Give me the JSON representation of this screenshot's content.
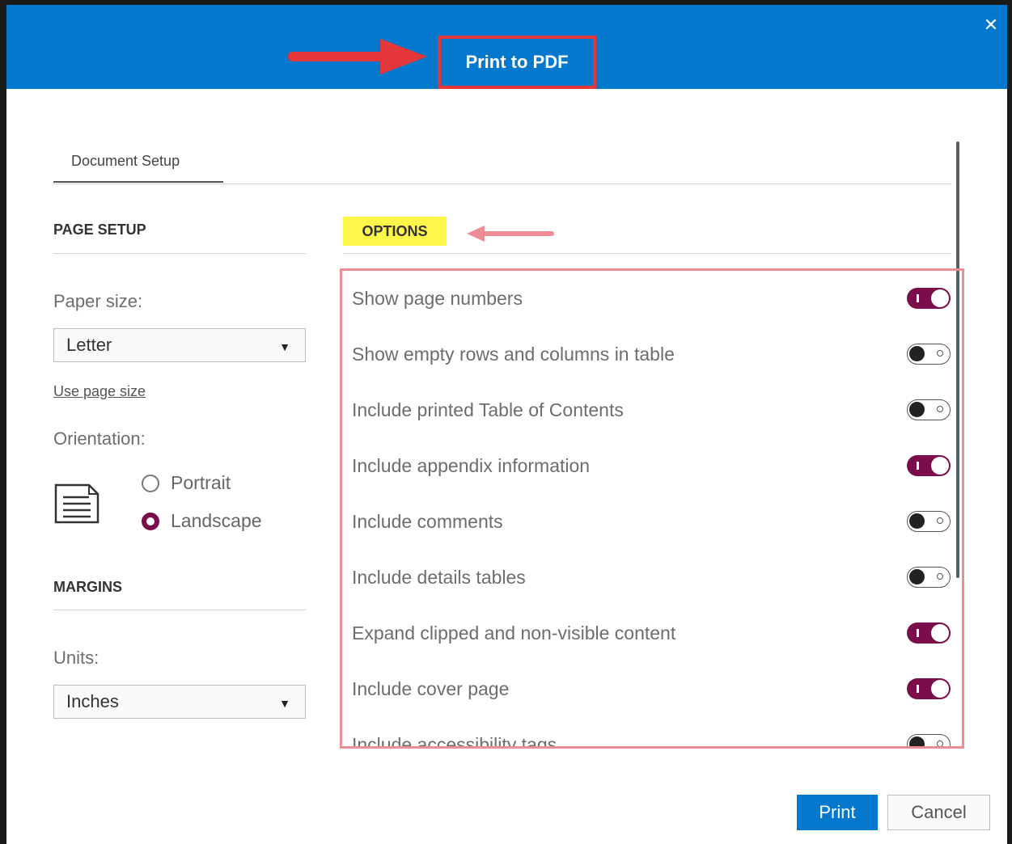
{
  "dialog": {
    "title": "Print to PDF",
    "close_icon": "close-icon",
    "accent_color": "#0378cd",
    "toggle_on_color": "#7a0d4a"
  },
  "tabs": [
    {
      "label": "Document Setup",
      "active": true
    }
  ],
  "page_setup": {
    "title": "PAGE SETUP",
    "paper_size_label": "Paper size:",
    "paper_size_value": "Letter",
    "use_page_size_link": "Use page size",
    "orientation_label": "Orientation:",
    "orientation_icon": "document-icon",
    "orientation_options": [
      {
        "label": "Portrait",
        "selected": false
      },
      {
        "label": "Landscape",
        "selected": true
      }
    ]
  },
  "margins": {
    "title": "MARGINS",
    "units_label": "Units:",
    "units_value": "Inches"
  },
  "options": {
    "title": "OPTIONS",
    "items": [
      {
        "label": "Show page numbers",
        "on": true
      },
      {
        "label": "Show empty rows and columns in table",
        "on": false
      },
      {
        "label": "Include printed Table of Contents",
        "on": false
      },
      {
        "label": "Include appendix information",
        "on": true
      },
      {
        "label": "Include comments",
        "on": false
      },
      {
        "label": "Include details tables",
        "on": false
      },
      {
        "label": "Expand clipped and non-visible content",
        "on": true
      },
      {
        "label": "Include cover page",
        "on": true
      },
      {
        "label": "Include accessibility tags",
        "on": false
      }
    ]
  },
  "footer": {
    "print_label": "Print",
    "cancel_label": "Cancel"
  }
}
